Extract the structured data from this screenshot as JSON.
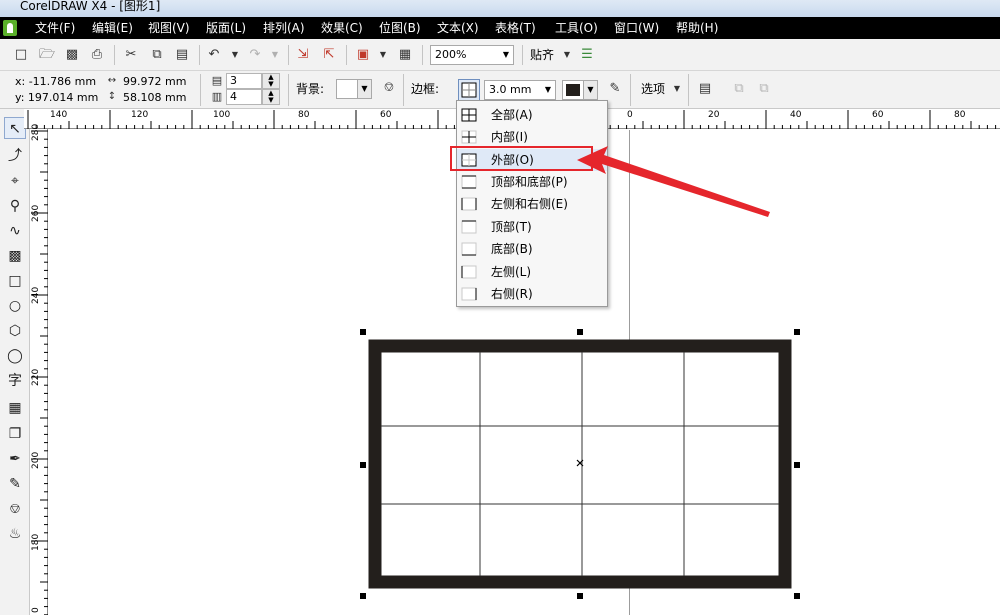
{
  "window": {
    "title": "CorelDRAW X4 - [图形1]"
  },
  "menu": {
    "items": [
      {
        "label": "文件(F)"
      },
      {
        "label": "编辑(E)"
      },
      {
        "label": "视图(V)"
      },
      {
        "label": "版面(L)"
      },
      {
        "label": "排列(A)"
      },
      {
        "label": "效果(C)"
      },
      {
        "label": "位图(B)"
      },
      {
        "label": "文本(X)"
      },
      {
        "label": "表格(T)"
      },
      {
        "label": "工具(O)"
      },
      {
        "label": "窗口(W)"
      },
      {
        "label": "帮助(H)"
      }
    ]
  },
  "standard_toolbar": {
    "zoom": "200%",
    "snap_label": "贴齐"
  },
  "property_bar": {
    "x": "x: -11.786 mm",
    "y": "y: 197.014 mm",
    "width": "99.972 mm",
    "height": "58.108 mm",
    "rows": "3",
    "cols": "4",
    "background_label": "背景:",
    "border_label": "边框:",
    "border_width": "3.0 mm",
    "options_label": "选项"
  },
  "ruler_top": {
    "labels": [
      "140",
      "120",
      "100",
      "80",
      "60",
      "0",
      "20",
      "40",
      "60",
      "80"
    ]
  },
  "ruler_left": {
    "labels": [
      "280",
      "260",
      "240",
      "220",
      "200",
      "180",
      "0"
    ]
  },
  "border_menu": {
    "items": [
      {
        "label": "全部(A)",
        "icon": "grid-all-icon"
      },
      {
        "label": "内部(I)",
        "icon": "grid-inside-icon"
      },
      {
        "label": "外部(O)",
        "icon": "grid-outside-icon"
      },
      {
        "label": "顶部和底部(P)",
        "icon": "grid-top-bottom-icon"
      },
      {
        "label": "左侧和右侧(E)",
        "icon": "grid-left-right-icon"
      },
      {
        "label": "顶部(T)",
        "icon": "grid-top-icon"
      },
      {
        "label": "底部(B)",
        "icon": "grid-bottom-icon"
      },
      {
        "label": "左侧(L)",
        "icon": "grid-left-icon"
      },
      {
        "label": "右侧(R)",
        "icon": "grid-right-icon"
      }
    ],
    "highlighted_index": 2
  },
  "colors": {
    "menubar_bg": "#000000",
    "annotation_red": "#e5262c",
    "table_border": "#231f1c"
  }
}
